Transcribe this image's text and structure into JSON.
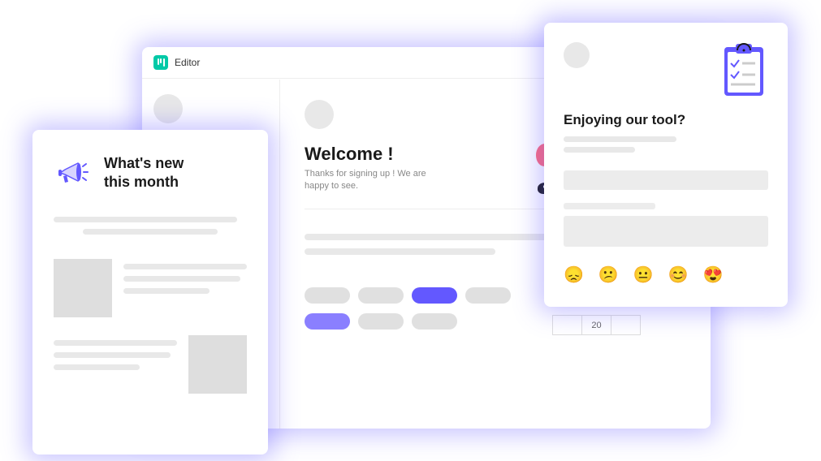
{
  "editor": {
    "header_label": "Editor",
    "welcome_title": "Welcome !",
    "welcome_sub": "Thanks for signing up ! We are happy to see."
  },
  "left_card": {
    "title_line1": "What's new",
    "title_line2": "this month"
  },
  "right_card": {
    "title": "Enjoying our tool?",
    "emojis": [
      "😞",
      "😕",
      "😐",
      "😊",
      "😍"
    ]
  },
  "tiny_table": {
    "value": "20"
  }
}
